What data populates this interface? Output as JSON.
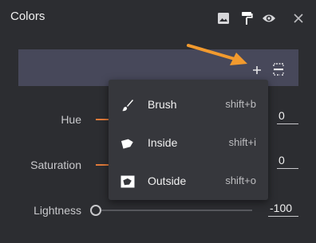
{
  "panel": {
    "title": "Colors",
    "toolbar_icons": [
      "image-icon",
      "paint-roller-icon",
      "eye-icon",
      "close-icon"
    ]
  },
  "preview": {
    "icons": [
      "plus-icon",
      "dotted-split-icon"
    ],
    "add_symbol": "+"
  },
  "controls": [
    {
      "label": "Hue",
      "value": "0"
    },
    {
      "label": "Saturation",
      "value": "0"
    },
    {
      "label": "Lightness",
      "value": "-100"
    }
  ],
  "menu": {
    "items": [
      {
        "label": "Brush",
        "shortcut": "shift+b",
        "icon": "brush-icon"
      },
      {
        "label": "Inside",
        "shortcut": "shift+i",
        "icon": "inside-icon"
      },
      {
        "label": "Outside",
        "shortcut": "shift+o",
        "icon": "outside-icon"
      }
    ]
  },
  "colors": {
    "accent": "#e07a3a",
    "arrow": "#f29a2e",
    "panel_bg": "#2c2d31",
    "preview_bg": "#47485a",
    "menu_bg": "#36373c"
  }
}
